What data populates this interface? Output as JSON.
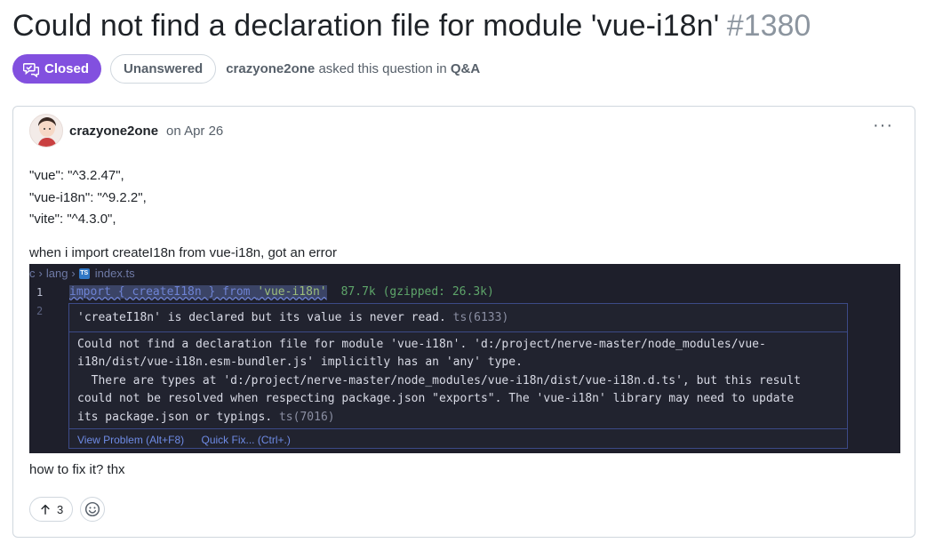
{
  "discussion": {
    "title": "Could not find a declaration file for module 'vue-i18n'",
    "number": "#1380",
    "status_label": "Closed",
    "answer_status": "Unanswered",
    "author": "crazyone2one",
    "asked_text": "asked this question in",
    "category": "Q&A"
  },
  "post": {
    "author": "crazyone2one",
    "date": "on Apr 26",
    "menu_glyph": "···",
    "deps": [
      "\"vue\": \"^3.2.47\",",
      "\"vue-i18n\": \"^9.2.2\",",
      "\"vite\": \"^4.3.0\","
    ],
    "intro": "when i import createI18n from vue-i18n, got an error",
    "outro": "how to fix it? thx",
    "upvotes": "3"
  },
  "screenshot": {
    "breadcrumb": [
      "c",
      "lang",
      "index.ts"
    ],
    "line_numbers": [
      "1",
      "2"
    ],
    "code_prefix": "import { createI18n } from ",
    "code_module": "'vue-i18n'",
    "import_cost": "87.7k (gzipped: 26.3k)",
    "hover_unused": "'createI18n' is declared but its value is never read.",
    "hover_unused_code": "ts(6133)",
    "hover_error_lines": [
      "Could not find a declaration file for module 'vue-i18n'. 'd:/project/nerve-master/node_modules/vue-",
      "i18n/dist/vue-i18n.esm-bundler.js' implicitly has an 'any' type.",
      "  There are types at 'd:/project/nerve-master/node_modules/vue-i18n/dist/vue-i18n.d.ts', but this result",
      "could not be resolved when respecting package.json \"exports\". The 'vue-i18n' library may need to update",
      "its package.json or typings."
    ],
    "hover_error_code": "ts(7016)",
    "actions": [
      "View Problem (Alt+F8)",
      "Quick Fix... (Ctrl+.)"
    ]
  },
  "colors": {
    "closed_badge": "#8250df",
    "editor_bg": "#1e1f2b",
    "link_blue": "#6e8be5"
  }
}
